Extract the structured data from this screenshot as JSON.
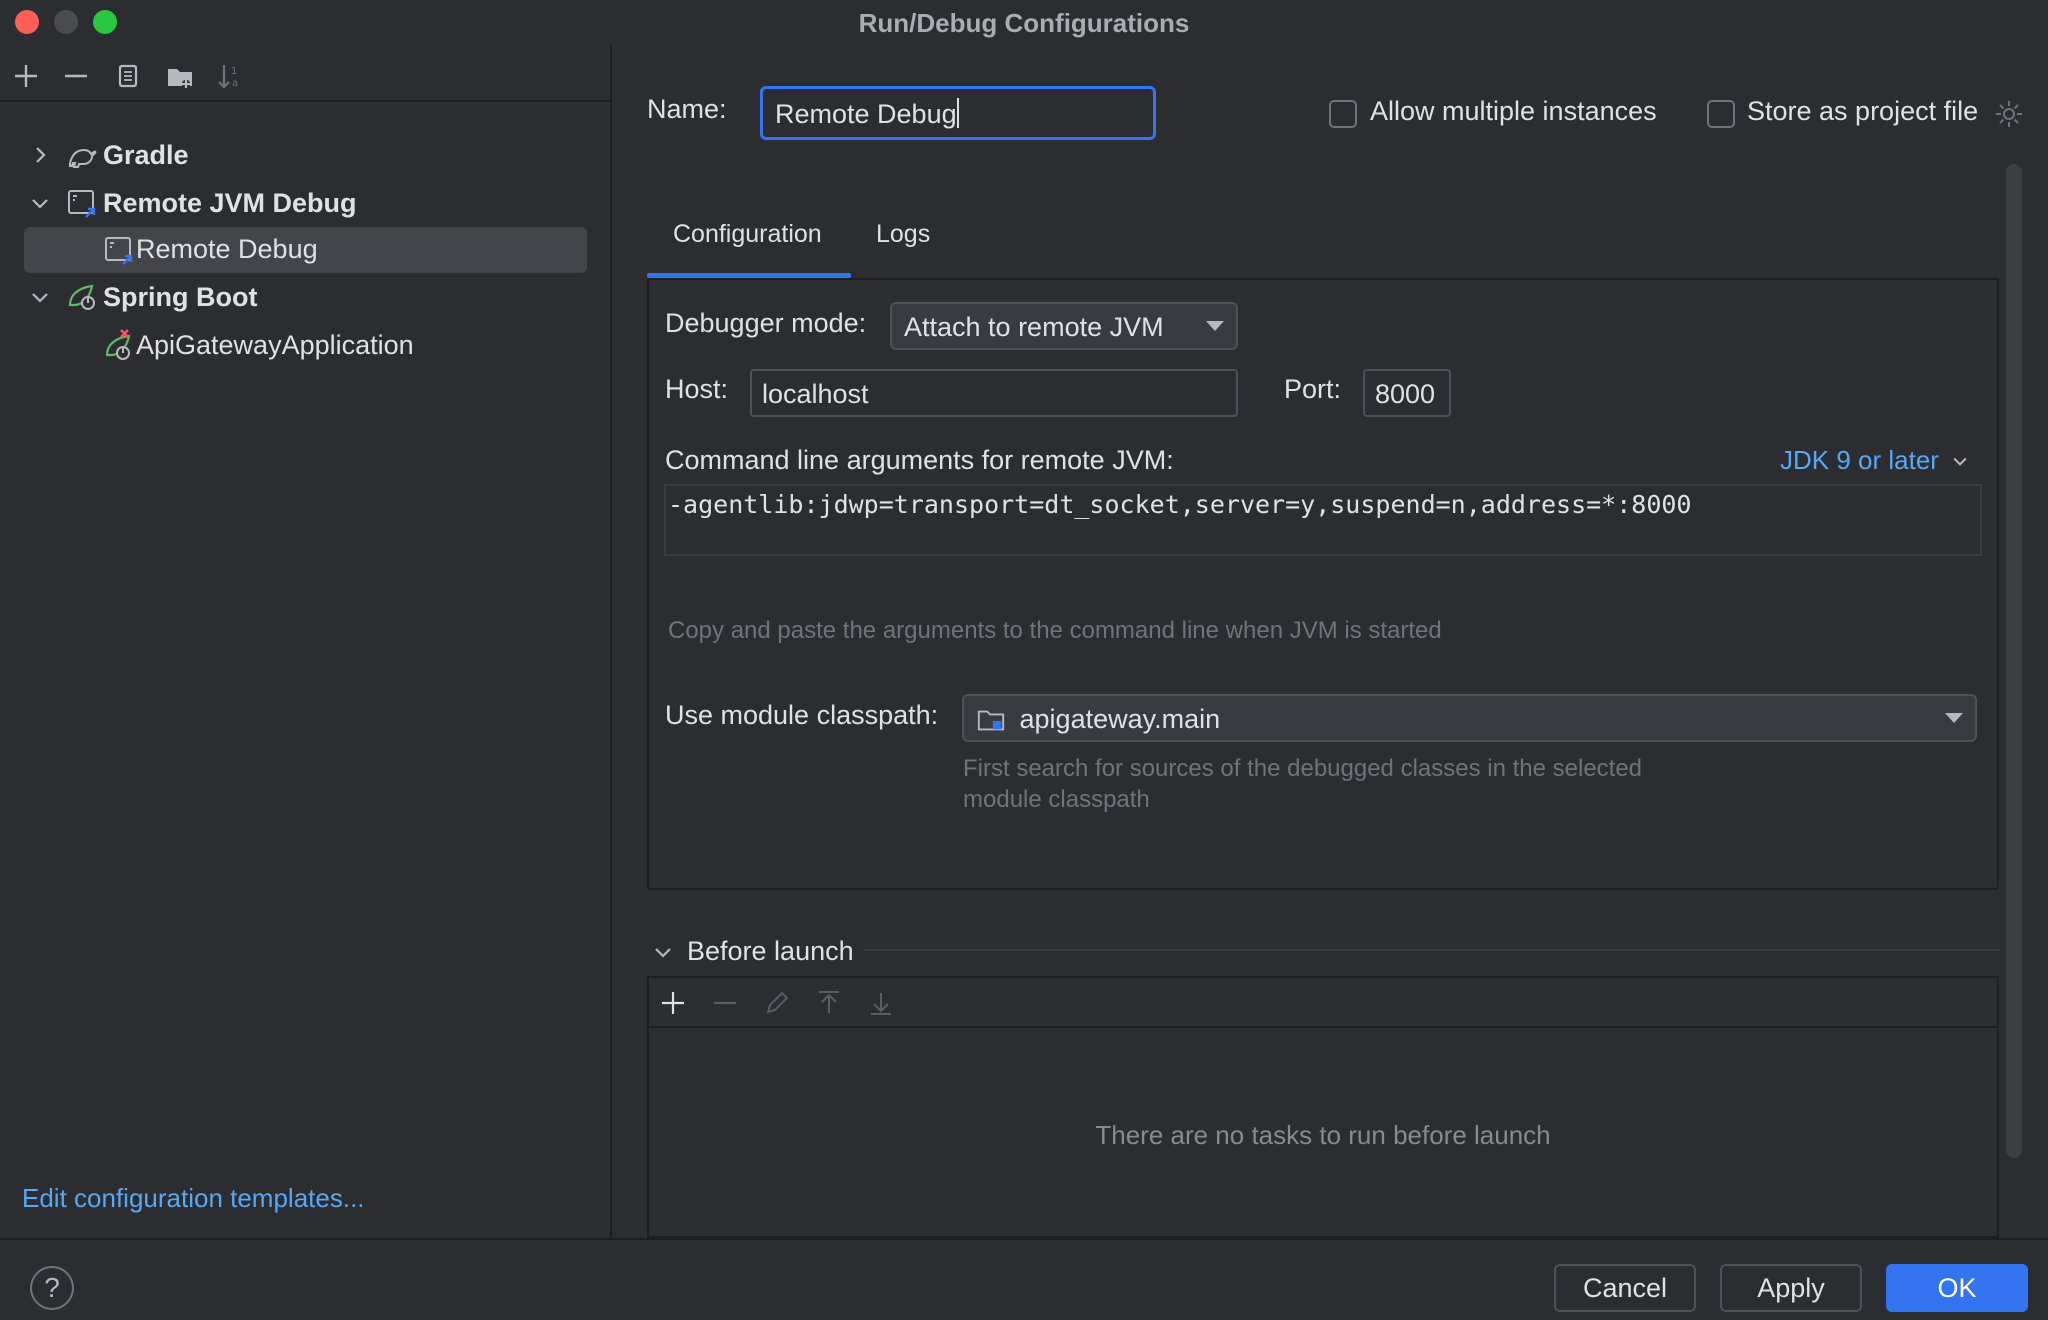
{
  "window": {
    "title": "Run/Debug Configurations"
  },
  "left_toolbar": {
    "icons": [
      "add-icon",
      "remove-icon",
      "copy-icon",
      "new-folder-icon",
      "sort-icon"
    ]
  },
  "tree": {
    "gradle": {
      "label": "Gradle",
      "expanded": false
    },
    "remote_jvm_debug": {
      "label": "Remote JVM Debug",
      "expanded": true
    },
    "remote_debug": {
      "label": "Remote Debug",
      "selected": true
    },
    "spring_boot": {
      "label": "Spring Boot",
      "expanded": true
    },
    "api_gateway": {
      "label": "ApiGatewayApplication"
    }
  },
  "edit_templates_link": "Edit configuration templates...",
  "header": {
    "name_label": "Name:",
    "name_value": "Remote Debug",
    "allow_multiple_label": "Allow multiple instances",
    "allow_multiple_checked": false,
    "store_project_label": "Store as project file",
    "store_project_checked": false
  },
  "tabs": [
    {
      "label": "Configuration",
      "active": true
    },
    {
      "label": "Logs",
      "active": false
    }
  ],
  "config": {
    "debugger_mode_label": "Debugger mode:",
    "debugger_mode_value": "Attach to remote JVM",
    "host_label": "Host:",
    "host_value": "localhost",
    "port_label": "Port:",
    "port_value": "8000",
    "cmd_args_label": "Command line arguments for remote JVM:",
    "jdk_link": "JDK 9 or later",
    "cmd_args_value": "-agentlib:jdwp=transport=dt_socket,server=y,suspend=n,address=*:8000",
    "cmd_args_hint": "Copy and paste the arguments to the command line when JVM is started",
    "module_label": "Use module classpath:",
    "module_value": "apigateway.main",
    "module_hint_line1": "First search for sources of the debugged classes in the selected",
    "module_hint_line2": "module classpath"
  },
  "before_launch": {
    "title": "Before launch",
    "toolbar_icons": [
      "add-icon",
      "remove-icon",
      "edit-icon",
      "move-up-icon",
      "move-down-icon"
    ],
    "empty_message": "There are no tasks to run before launch"
  },
  "buttons": {
    "help": "?",
    "cancel": "Cancel",
    "apply": "Apply",
    "ok": "OK"
  },
  "colors": {
    "accent": "#3574f0",
    "link": "#56a8f5",
    "background": "#2b2d30",
    "selection": "#43454a"
  }
}
